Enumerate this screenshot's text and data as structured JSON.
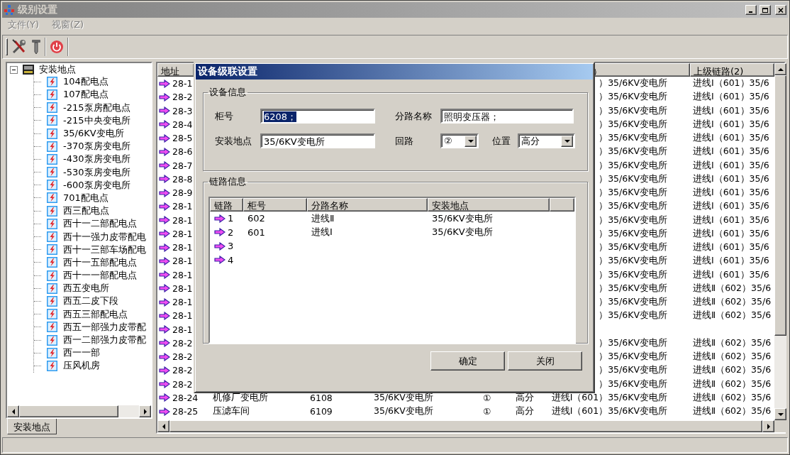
{
  "window": {
    "title": "级别设置",
    "active": false
  },
  "menu": [
    {
      "label": "文件(Y)",
      "disabled": true
    },
    {
      "label": "视窗(Z)",
      "disabled": true
    }
  ],
  "tree": {
    "root": "安装地点",
    "expanded": true,
    "children": [
      {
        "label": "104配电点"
      },
      {
        "label": "107配电点"
      },
      {
        "label": "-215泵房配电点"
      },
      {
        "label": "-215中央变电所"
      },
      {
        "label": "35/6KV变电所"
      },
      {
        "label": "-370泵房变电所"
      },
      {
        "label": "-430泵房变电所"
      },
      {
        "label": "-530泵房变电所"
      },
      {
        "label": "-600泵房变电所"
      },
      {
        "label": "701配电点"
      },
      {
        "label": "西三配电点"
      },
      {
        "label": "西十一二部配电点"
      },
      {
        "label": "西十一强力皮带配电"
      },
      {
        "label": "西十一三部车场配电"
      },
      {
        "label": "西十一五部配电点"
      },
      {
        "label": "西十一一部配电点"
      },
      {
        "label": "西五变电所"
      },
      {
        "label": "西五二皮下段"
      },
      {
        "label": "西五三部配电点"
      },
      {
        "label": "西五一部强力皮带配"
      },
      {
        "label": "西一二部强力皮带配"
      },
      {
        "label": "西一一部"
      },
      {
        "label": "压风机房"
      }
    ]
  },
  "left_tabs": [
    {
      "label": "安装地点",
      "selected": true
    }
  ],
  "list": {
    "header": {
      "address": "地址",
      "link1": "）",
      "link2": "上级链路(2)"
    },
    "rows": [
      {
        "address": "28-1",
        "link1": "）35/6KV变电所",
        "link2": "进线Ⅰ（601）35/6"
      },
      {
        "address": "28-2",
        "link1": "）35/6KV变电所",
        "link2": "进线Ⅰ（601）35/6"
      },
      {
        "address": "28-3",
        "link1": "）35/6KV变电所",
        "link2": "进线Ⅰ（601）35/6"
      },
      {
        "address": "28-4",
        "link1": "）35/6KV变电所",
        "link2": "进线Ⅰ（601）35/6"
      },
      {
        "address": "28-5",
        "link1": "）35/6KV变电所",
        "link2": "进线Ⅰ（601）35/6"
      },
      {
        "address": "28-6",
        "link1": "）35/6KV变电所",
        "link2": "进线Ⅰ（601）35/6"
      },
      {
        "address": "28-7",
        "link1": "）35/6KV变电所",
        "link2": "进线Ⅰ（601）35/6"
      },
      {
        "address": "28-8",
        "link1": "）35/6KV变电所",
        "link2": "进线Ⅰ（601）35/6"
      },
      {
        "address": "28-9",
        "link1": "）35/6KV变电所",
        "link2": "进线Ⅰ（601）35/6"
      },
      {
        "address": "28-1",
        "link1": "）35/6KV变电所",
        "link2": "进线Ⅰ（601）35/6"
      },
      {
        "address": "28-1",
        "link1": "）35/6KV变电所",
        "link2": "进线Ⅰ（601）35/6"
      },
      {
        "address": "28-1",
        "link1": "）35/6KV变电所",
        "link2": "进线Ⅰ（601）35/6"
      },
      {
        "address": "28-1",
        "link1": "）35/6KV变电所",
        "link2": "进线Ⅰ（601）35/6"
      },
      {
        "address": "28-1",
        "link1": "）35/6KV变电所",
        "link2": "进线Ⅰ（601）35/6"
      },
      {
        "address": "28-1",
        "link1": "）35/6KV变电所",
        "link2": "进线Ⅰ（601）35/6"
      },
      {
        "address": "28-1",
        "link1": "）35/6KV变电所",
        "link2": "进线Ⅱ（602）35/6"
      },
      {
        "address": "28-1",
        "link1": "）35/6KV变电所",
        "link2": "进线Ⅱ（602）35/6"
      },
      {
        "address": "28-1",
        "link1": "）35/6KV变电所",
        "link2": "进线Ⅱ（602）35/6"
      },
      {
        "address": "28-1"
      },
      {
        "address": "28-2",
        "link1": "）35/6KV变电所",
        "link2": "进线Ⅱ（602）35/6"
      },
      {
        "address": "28-2",
        "link1": "）35/6KV变电所",
        "link2": "进线Ⅱ（602）35/6"
      },
      {
        "address": "28-2",
        "link1": "）35/6KV变电所",
        "link2": "进线Ⅱ（602）35/6"
      },
      {
        "address": "28-2",
        "link1": "）35/6KV变电所",
        "link2": "进线Ⅱ（602）35/6"
      },
      {
        "address": "28-24",
        "name": "机修厂变电所",
        "cabinet": "6108",
        "location": "35/6KV变电所",
        "circuit": "①",
        "position": "高分",
        "link1": "进线Ⅰ（601）35/6KV变电所",
        "link2": "进线Ⅱ（602）35/6"
      },
      {
        "address": "28-25",
        "name": "压滤车间",
        "cabinet": "6109",
        "location": "35/6KV变电所",
        "circuit": "①",
        "position": "高分",
        "link1": "进线Ⅰ（601）35/6KV变电所",
        "link2": "进线Ⅱ（602）35/6"
      }
    ]
  },
  "dialog": {
    "title": "设备级联设置",
    "device_info": {
      "title": "设备信息",
      "cabinet": {
        "label": "柜号",
        "value": "6208；",
        "selected": true
      },
      "branch": {
        "label": "分路名称",
        "value": "照明变压器；",
        "selected": false
      },
      "location": {
        "label": "安装地点",
        "value": "35/6KV变电所",
        "selected": false
      },
      "circuit": {
        "label": "回路",
        "value": "②"
      },
      "position": {
        "label": "位置",
        "value": "高分"
      }
    },
    "link_info": {
      "title": "链路信息",
      "columns": [
        "链路",
        "柜号",
        "分路名称",
        "安装地点"
      ],
      "rows": [
        {
          "link": "1",
          "cabinet": "602",
          "branch": "进线Ⅱ",
          "location": "35/6KV变电所"
        },
        {
          "link": "2",
          "cabinet": "601",
          "branch": "进线Ⅰ",
          "location": "35/6KV变电所"
        },
        {
          "link": "3"
        },
        {
          "link": "4"
        }
      ]
    },
    "buttons": [
      "确定",
      "关闭"
    ]
  }
}
